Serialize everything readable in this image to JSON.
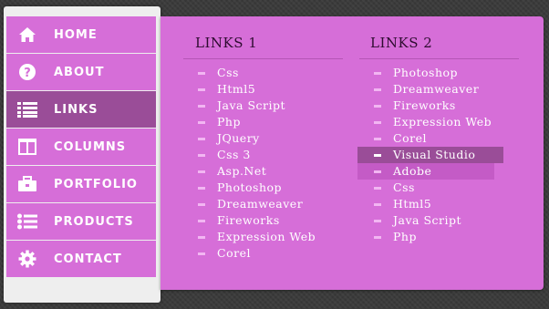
{
  "menu": [
    {
      "label": "HOME",
      "icon": "home-icon"
    },
    {
      "label": "ABOUT",
      "icon": "question-icon"
    },
    {
      "label": "LINKS",
      "icon": "list-icon"
    },
    {
      "label": "COLUMNS",
      "icon": "columns-icon"
    },
    {
      "label": "PORTFOLIO",
      "icon": "briefcase-icon"
    },
    {
      "label": "PRODUCTS",
      "icon": "bullet-list-icon"
    },
    {
      "label": "CONTACT",
      "icon": "gear-icon"
    }
  ],
  "active_menu": "LINKS",
  "dropdown": {
    "col1": {
      "title": "LINKS 1",
      "items": [
        "Css",
        "Html5",
        "Java Script",
        "Php",
        "JQuery",
        "Css 3",
        "Asp.Net",
        "Photoshop",
        "Dreamweaver",
        "Fireworks",
        "Expression Web",
        "Corel"
      ]
    },
    "col2": {
      "title": "LINKS 2",
      "items": [
        "Photoshop",
        "Dreamweaver",
        "Fireworks",
        "Expression Web",
        "Corel",
        "Visual Studio",
        "Adobe",
        "Css",
        "Html5",
        "Java Script",
        "Php"
      ],
      "highlighted": "Visual Studio"
    }
  },
  "colors": {
    "accent": "#d66ed8",
    "active": "#9a4d98",
    "background": "#3b3b3b"
  }
}
